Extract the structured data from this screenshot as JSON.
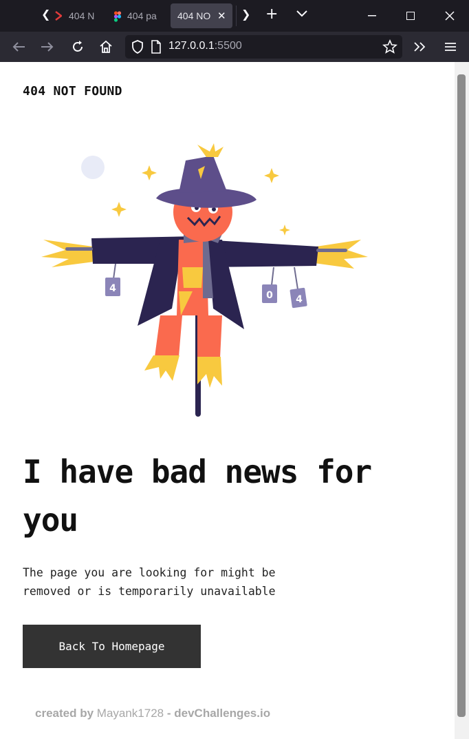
{
  "browser": {
    "tabs": [
      {
        "title": "404 N"
      },
      {
        "title": "404 pa"
      },
      {
        "title": "404 NO"
      }
    ],
    "url_host": "127.0.0.1",
    "url_port": ":5500"
  },
  "page": {
    "brand": "404 NOT FOUND",
    "illustration_digits": [
      "4",
      "0",
      "4"
    ],
    "headline": "I have bad news for you",
    "subtext": "The page you are looking for might be removed or is temporarily unavailable",
    "button_label": "Back To Homepage",
    "footer": {
      "created_by": "created by",
      "author": "Mayank1728",
      "separator": "-",
      "site": "devChallenges.io"
    }
  },
  "colors": {
    "text": "#111111",
    "button_bg": "#333333",
    "hat": "#5d4e8a",
    "coat": "#2b2450",
    "pumpkin": "#fa6a4e",
    "straw": "#f8c93f"
  }
}
